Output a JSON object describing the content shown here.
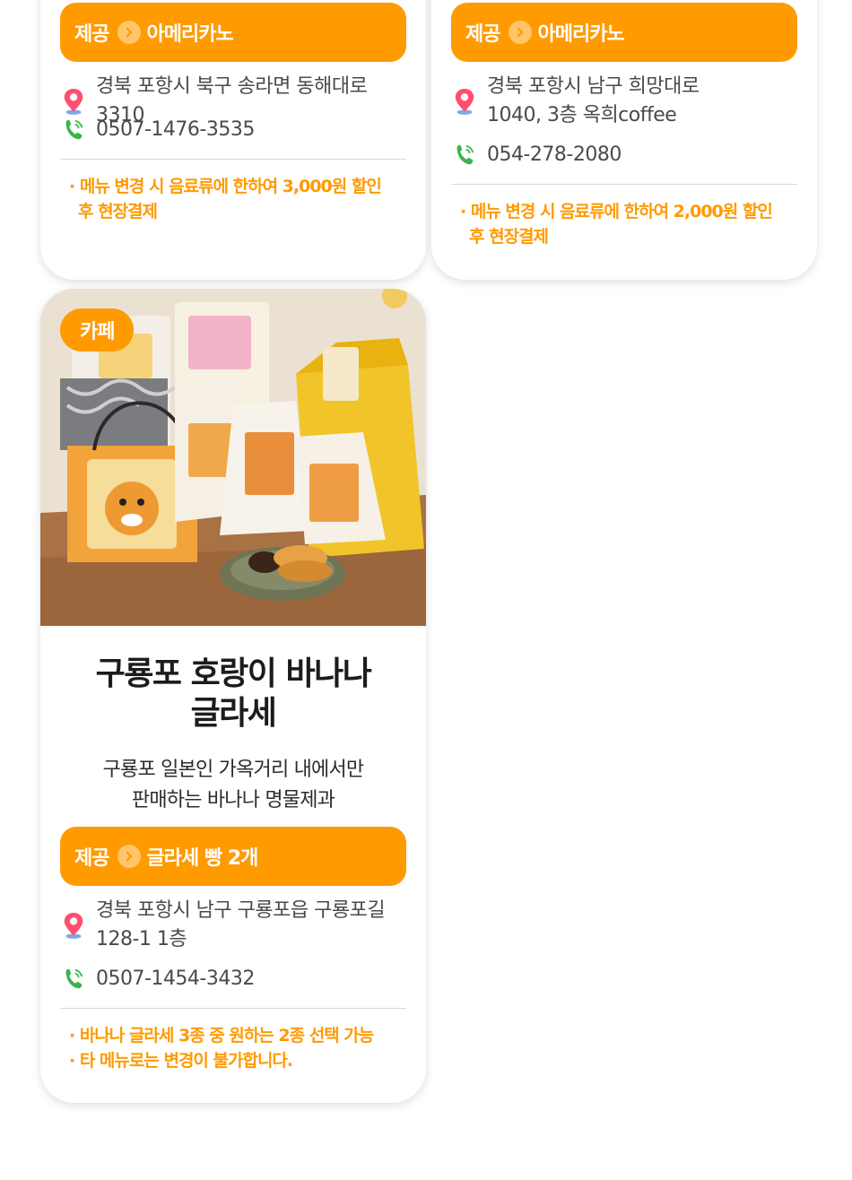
{
  "cards": [
    {
      "offer_label": "제공",
      "offer_item": "아메리카노",
      "address": "경북 포항시 북구 송라면 동해대로 3310",
      "phone": "0507-1476-3535",
      "notes": [
        "· 메뉴 변경 시 음료류에 한하여 3,000원 할인 후 현장결제"
      ]
    },
    {
      "offer_label": "제공",
      "offer_item": "아메리카노",
      "address_lines": [
        "경북 포항시 남구 희망대로",
        "1040, 3층 옥희coffee"
      ],
      "phone": "054-278-2080",
      "notes": [
        "· 메뉴 변경 시 음료류에 한하여 2,000원 할인 후 현장결제"
      ]
    },
    {
      "category": "카페",
      "title_lines": [
        "구룡포 호랑이 바나나",
        "글라세"
      ],
      "desc_lines": [
        "구룡포 일본인 가옥거리 내에서만",
        "판매하는 바나나 명물제과"
      ],
      "offer_label": "제공",
      "offer_item": "글라세 빵 2개",
      "address_lines": [
        "경북 포항시 남구 구룡포읍 구룡포길",
        "128-1 1층"
      ],
      "phone": "0507-1454-3432",
      "notes": [
        "· 바나나 글라세 3종 중 원하는 2종 선택 가능",
        "· 타 메뉴로는 변경이 불가합니다."
      ]
    }
  ],
  "colors": {
    "accent": "#ff9a00",
    "accent_light": "#ffc56a",
    "pin": "#ff4f6d",
    "phone": "#3cb44a"
  },
  "icons": [
    "location-pin-icon",
    "phone-icon",
    "chevron-right-icon"
  ]
}
